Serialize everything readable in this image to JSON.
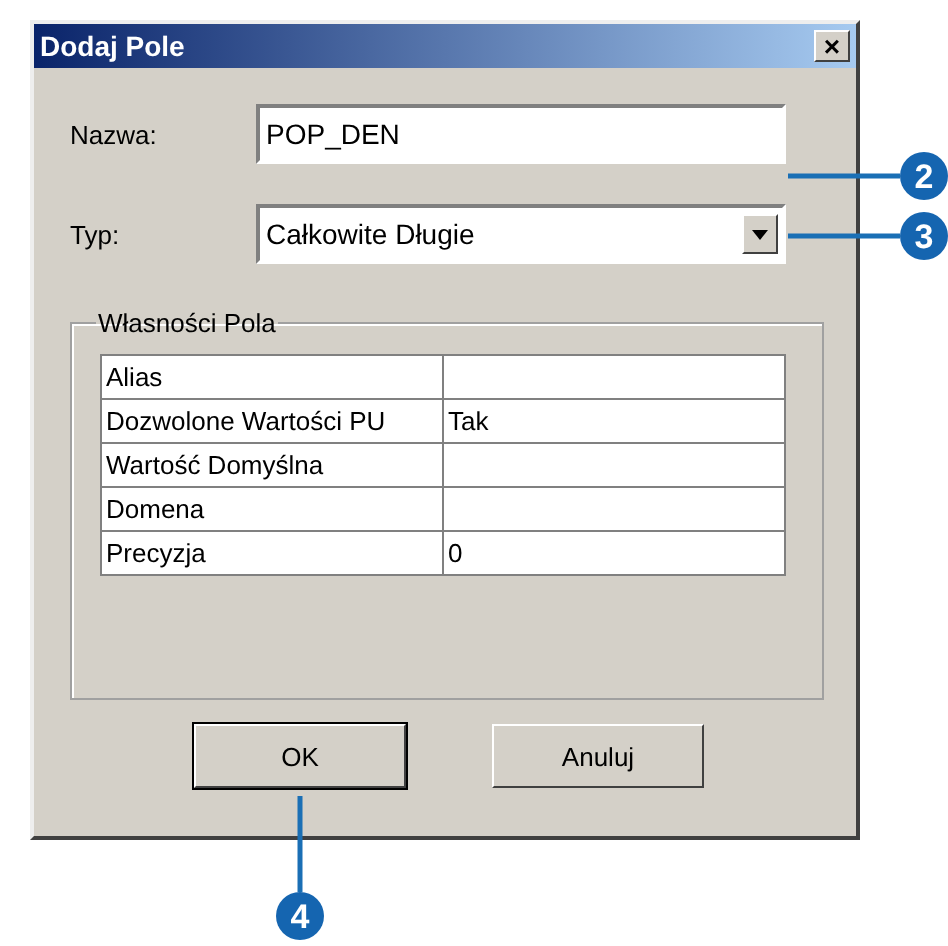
{
  "window": {
    "title": "Dodaj Pole",
    "close": "×"
  },
  "fields": [
    {
      "kind": "text",
      "label": "Nazwa:",
      "value": "POP_DEN"
    },
    {
      "kind": "dropdown",
      "label": "Typ:",
      "value": "Całkowite Długie"
    }
  ],
  "group": {
    "title": "Własności Pola",
    "rows": [
      {
        "name": "Alias",
        "value": ""
      },
      {
        "name": "Dozwolone Wartości PU",
        "value": "Tak"
      },
      {
        "name": "Wartość Domyślna",
        "value": ""
      },
      {
        "name": "Domena",
        "value": ""
      },
      {
        "name": "Precyzja",
        "value": "0"
      }
    ]
  },
  "buttons": [
    {
      "label": "OK",
      "default": true
    },
    {
      "label": "Anuluj",
      "default": false
    }
  ],
  "callouts": [
    {
      "label": "2"
    },
    {
      "label": "3"
    },
    {
      "label": "4"
    }
  ]
}
